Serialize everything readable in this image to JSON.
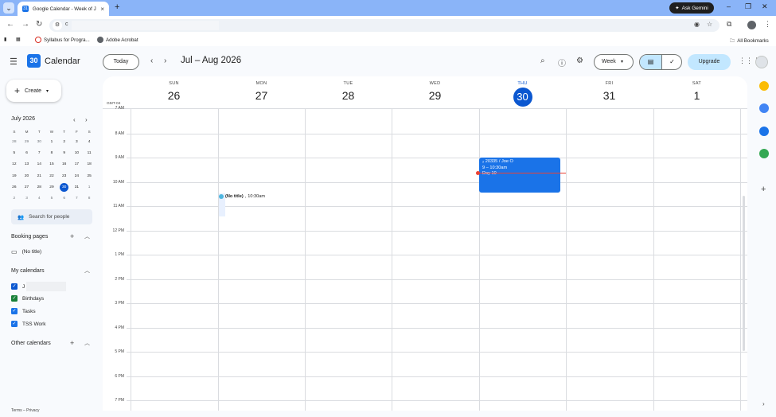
{
  "browser": {
    "tab_title": "Google Calendar - Week of July",
    "tab_close": "×",
    "new_tab": "+",
    "ask_gemini": "Ask Gemini",
    "url_fragment": "c",
    "bookmarks": [
      {
        "label": "Syllabus for Progra..."
      },
      {
        "label": "Adobe Acrobat"
      }
    ],
    "all_bookmarks": "All Bookmarks"
  },
  "header": {
    "app_title": "Calendar",
    "logo_day": "30",
    "today_label": "Today",
    "date_range": "Jul – Aug 2026",
    "view_label": "Week",
    "upgrade_label": "Upgrade"
  },
  "sidebar": {
    "create_label": "Create",
    "mini_month": "July 2026",
    "dow": [
      "S",
      "M",
      "T",
      "W",
      "T",
      "F",
      "S"
    ],
    "weeks": [
      [
        "28",
        "29",
        "30",
        "1",
        "2",
        "3",
        "4"
      ],
      [
        "5",
        "6",
        "7",
        "8",
        "9",
        "10",
        "11"
      ],
      [
        "12",
        "13",
        "14",
        "15",
        "16",
        "17",
        "18"
      ],
      [
        "19",
        "20",
        "21",
        "22",
        "23",
        "24",
        "25"
      ],
      [
        "26",
        "27",
        "28",
        "29",
        "30",
        "31",
        "1"
      ],
      [
        "2",
        "3",
        "4",
        "5",
        "6",
        "7",
        "8"
      ]
    ],
    "search_people": "Search for people",
    "booking_pages": "Booking pages",
    "booking_items": [
      "(No title)"
    ],
    "my_calendars": "My calendars",
    "calendars": [
      {
        "label": "J",
        "color": "#0b57d0"
      },
      {
        "label": "Birthdays",
        "color": "#188038"
      },
      {
        "label": "Tasks",
        "color": "#1a73e8"
      },
      {
        "label": "TSS Work",
        "color": "#1a73e8"
      }
    ],
    "other_calendars": "Other calendars",
    "footer": "Terms – Privacy"
  },
  "grid": {
    "timezone": "GMT-04",
    "days": [
      {
        "dow": "SUN",
        "num": "26"
      },
      {
        "dow": "MON",
        "num": "27"
      },
      {
        "dow": "TUE",
        "num": "28"
      },
      {
        "dow": "WED",
        "num": "29"
      },
      {
        "dow": "THU",
        "num": "30",
        "today": true
      },
      {
        "dow": "FRI",
        "num": "31"
      },
      {
        "dow": "SAT",
        "num": "1"
      }
    ],
    "hours": [
      "7 AM",
      "8 AM",
      "9 AM",
      "10 AM",
      "11 AM",
      "12 PM",
      "1 PM",
      "2 PM",
      "3 PM",
      "4 PM",
      "5 PM",
      "6 PM",
      "7 PM"
    ],
    "events": [
      {
        "title": "₂ 20335 / Joe O",
        "time": "9 – 10:30am",
        "extra": "Day 10"
      },
      {
        "title": "(No title)",
        "time": "10:30am"
      }
    ]
  },
  "colors": {
    "accent": "#0b57d0",
    "event_blue": "#1a73e8",
    "now_line": "#ea4335"
  }
}
